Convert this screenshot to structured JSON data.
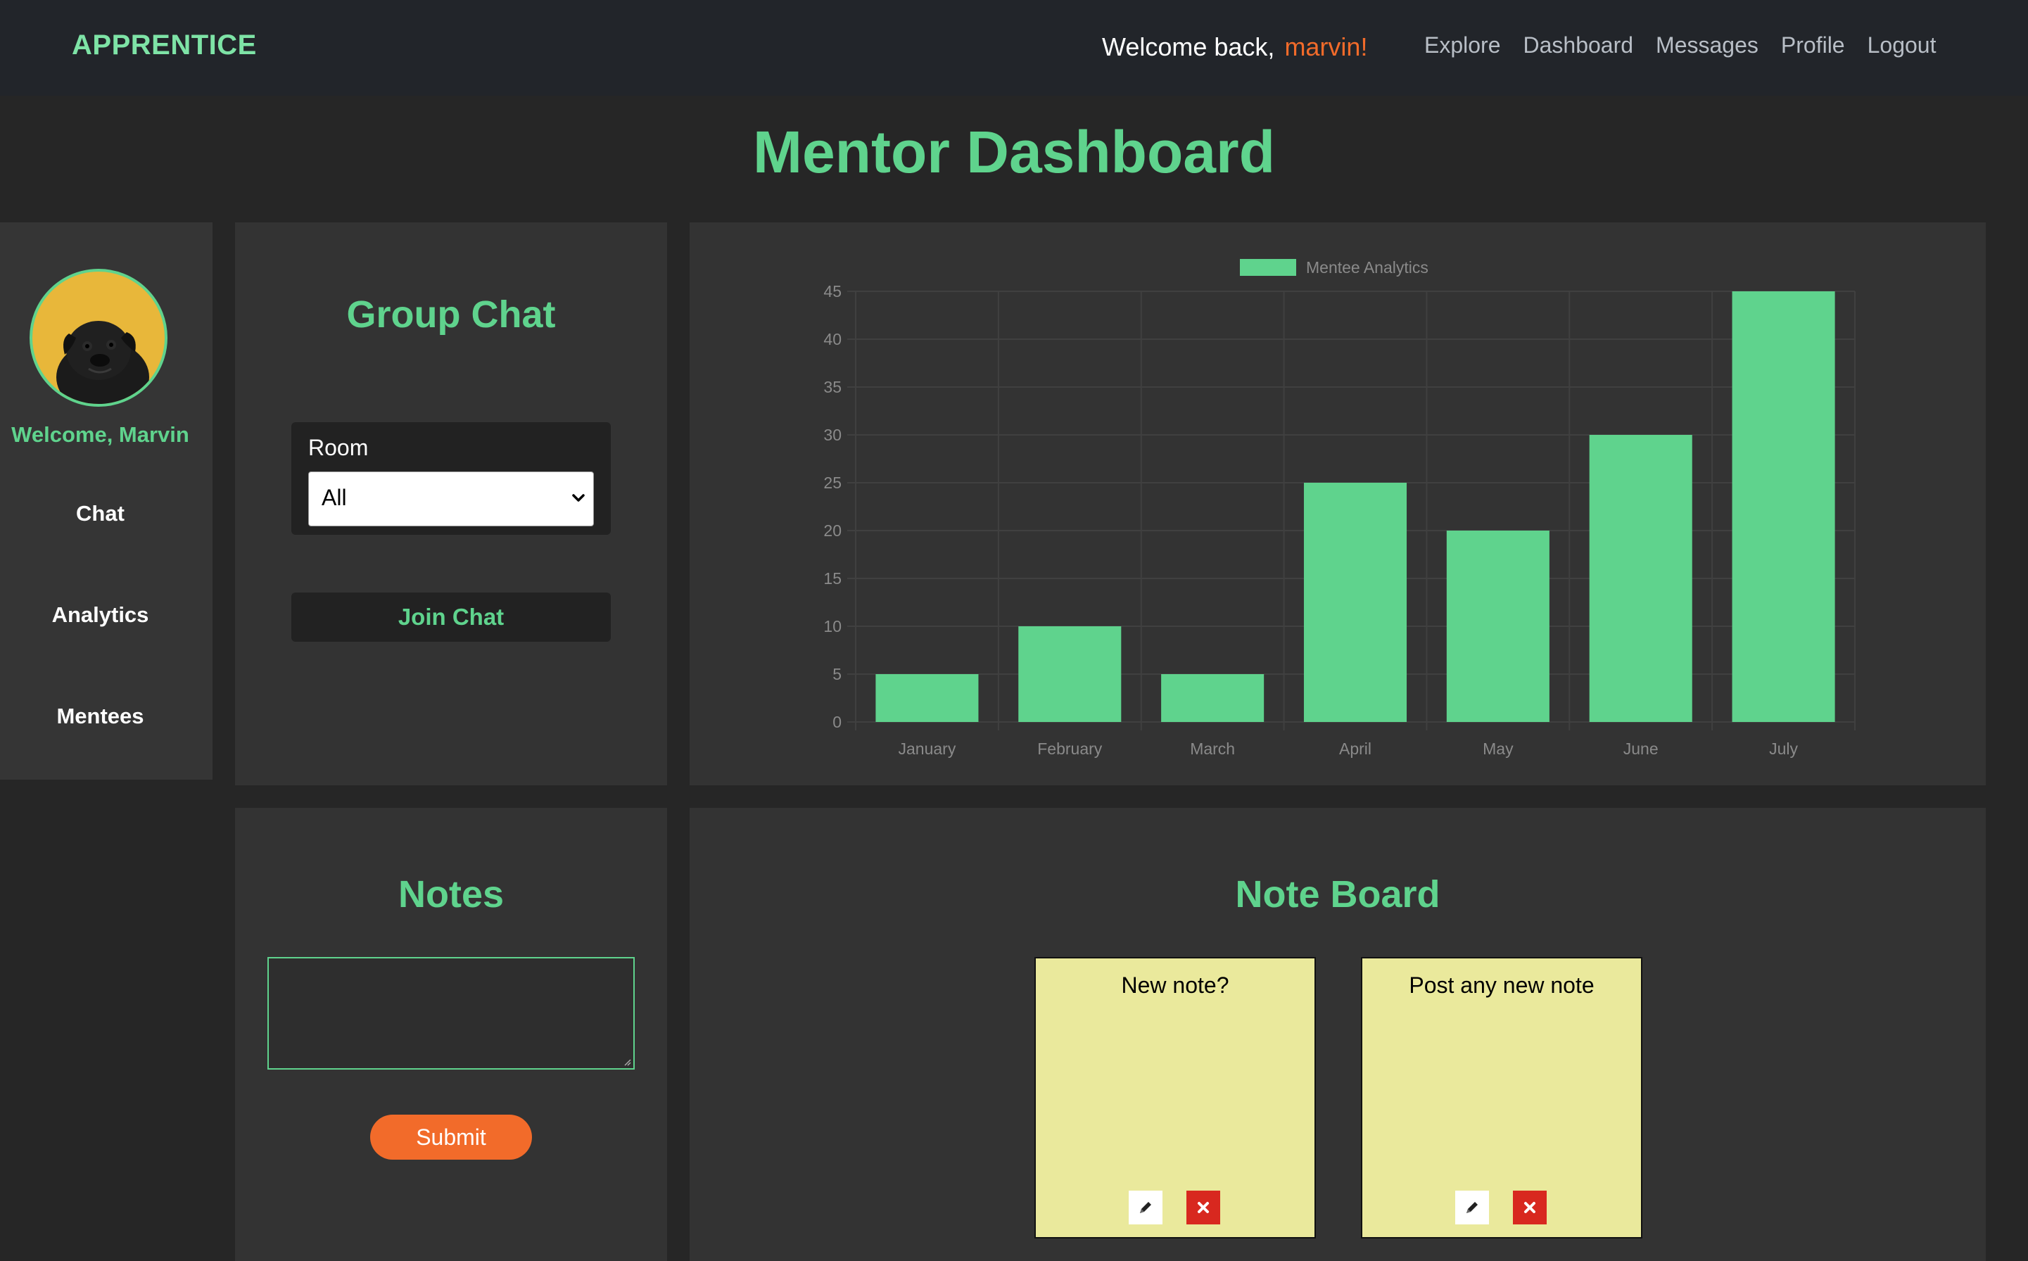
{
  "navbar": {
    "brand": "APPRENTICE",
    "welcome_prefix": "Welcome back,",
    "username": "marvin!",
    "links": [
      "Explore",
      "Dashboard",
      "Messages",
      "Profile",
      "Logout"
    ]
  },
  "page": {
    "title": "Mentor Dashboard"
  },
  "sidebar": {
    "welcome": "Welcome, Marvin",
    "items": [
      "Chat",
      "Analytics",
      "Mentees"
    ]
  },
  "group_chat": {
    "title": "Group Chat",
    "room_label": "Room",
    "room_selected": "All",
    "join_label": "Join Chat"
  },
  "chart_data": {
    "type": "bar",
    "categories": [
      "January",
      "February",
      "March",
      "April",
      "May",
      "June",
      "July"
    ],
    "series": [
      {
        "name": "Mentee Analytics",
        "values": [
          5,
          10,
          5,
          25,
          20,
          30,
          45
        ]
      }
    ],
    "ylim": [
      0,
      45
    ],
    "yticks": [
      0,
      5,
      10,
      15,
      20,
      25,
      30,
      35,
      40,
      45
    ],
    "grid": true,
    "legend": "top-center",
    "bar_color": "#5fd38d"
  },
  "notes": {
    "title": "Notes",
    "submit_label": "Submit"
  },
  "note_board": {
    "title": "Note Board",
    "notes": [
      {
        "text": "New note?"
      },
      {
        "text": "Post any new note"
      }
    ]
  },
  "colors": {
    "accent": "#5fd38d",
    "orange": "#f26b2a",
    "sticky": "#eae99c"
  }
}
